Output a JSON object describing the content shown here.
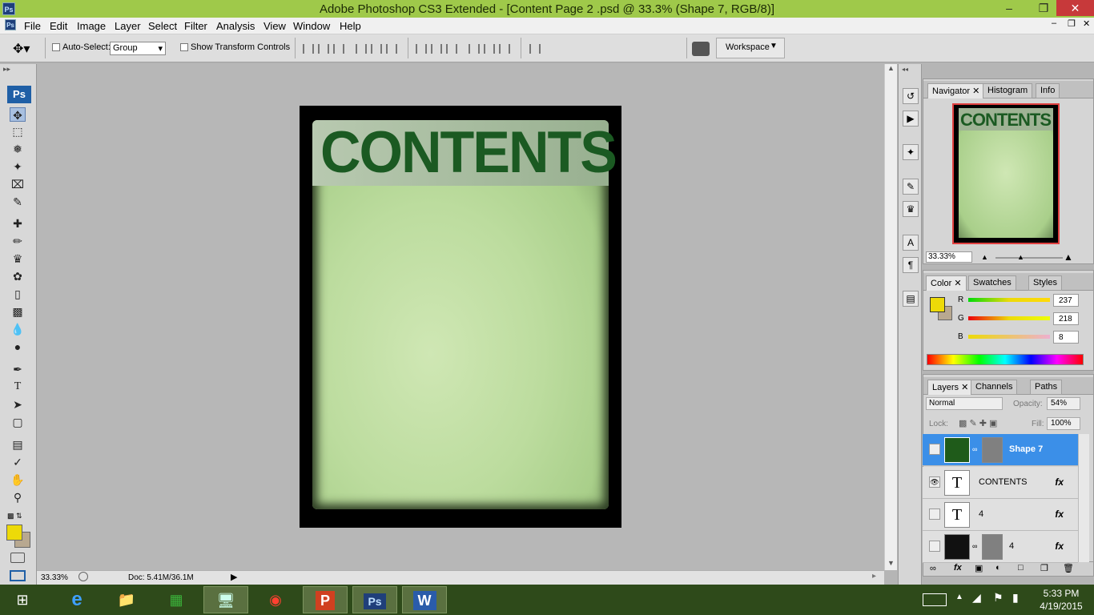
{
  "window": {
    "title": "Adobe Photoshop CS3 Extended - [Content Page 2 .psd @ 33.3% (Shape 7, RGB/8)]",
    "app_icon": "Ps"
  },
  "menu": [
    "File",
    "Edit",
    "Image",
    "Layer",
    "Select",
    "Filter",
    "Analysis",
    "View",
    "Window",
    "Help"
  ],
  "options": {
    "auto_select_label": "Auto-Select:",
    "auto_select_value": "Group",
    "show_transform_label": "Show Transform Controls",
    "workspace_label": "Workspace"
  },
  "document": {
    "heading": "CONTENTS"
  },
  "status": {
    "zoom": "33.33%",
    "doc": "Doc: 5.41M/36.1M"
  },
  "navigator": {
    "tabs": [
      "Navigator",
      "Histogram",
      "Info"
    ],
    "zoom": "33.33%",
    "preview_heading": "CONTENTS"
  },
  "color": {
    "tabs": [
      "Color",
      "Swatches",
      "Styles"
    ],
    "r_label": "R",
    "g_label": "G",
    "b_label": "B",
    "r": "237",
    "g": "218",
    "b": "8",
    "fg": "#edda08",
    "bg": "#b8a890"
  },
  "layers": {
    "tabs": [
      "Layers",
      "Channels",
      "Paths"
    ],
    "blend": "Normal",
    "opacity_label": "Opacity:",
    "opacity": "54%",
    "lock_label": "Lock:",
    "fill_label": "Fill:",
    "fill": "100%",
    "rows": [
      {
        "name": "Shape 7",
        "thumb": "",
        "fx": ""
      },
      {
        "name": "CONTENTS",
        "thumb": "T",
        "fx": "fx"
      },
      {
        "name": "4",
        "thumb": "T",
        "fx": "fx"
      },
      {
        "name": "4",
        "thumb": "",
        "fx": "fx"
      }
    ]
  },
  "taskbar": {
    "time": "5:33 PM",
    "date": "4/19/2015",
    "ps_label": "Ps",
    "word_label": "W",
    "ppt_label": "P"
  }
}
